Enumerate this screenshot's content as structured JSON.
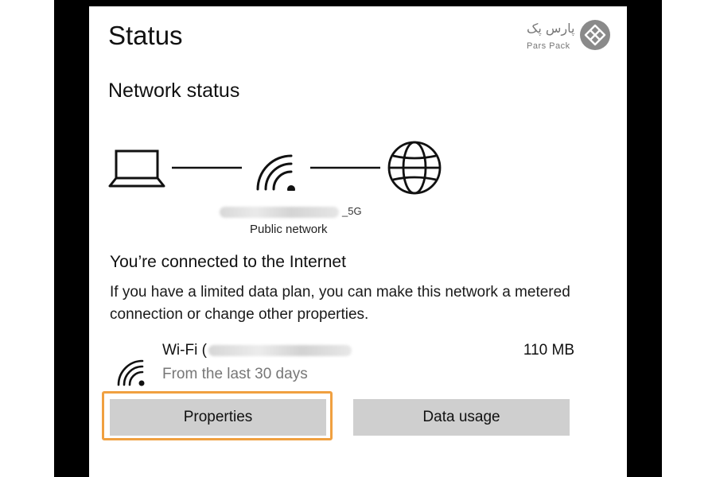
{
  "page": {
    "title": "Status",
    "section_heading": "Network status"
  },
  "logo": {
    "farsi": "پارس پک",
    "english": "Pars Pack"
  },
  "network": {
    "name_suffix": "_5G",
    "type": "Public network",
    "icons": [
      "laptop-icon",
      "wifi-icon",
      "globe-icon"
    ]
  },
  "connection": {
    "heading": "You’re connected to the Internet",
    "description": "If you have a limited data plan, you can make this network a metered connection or change other properties."
  },
  "wifi_usage": {
    "label_prefix": "Wi-Fi (",
    "period": "From the last 30 days",
    "amount": "110 MB"
  },
  "buttons": {
    "properties": "Properties",
    "data_usage": "Data usage"
  },
  "colors": {
    "highlight": "#f0a040",
    "button_bg": "#cfcfcf",
    "frame": "#000000"
  }
}
